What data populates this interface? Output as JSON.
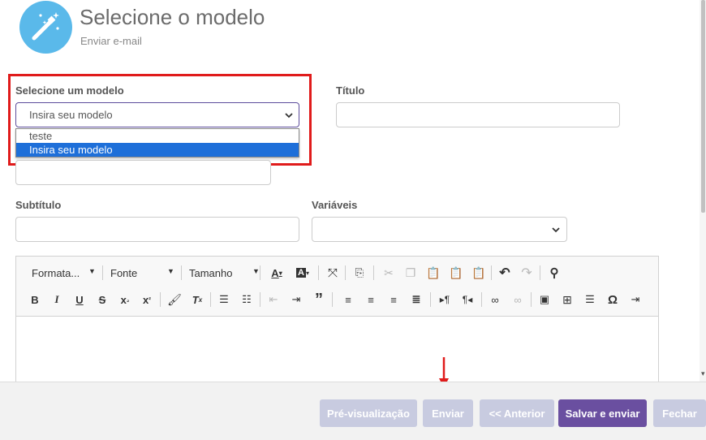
{
  "header": {
    "title": "Selecione o modelo",
    "subtitle": "Enviar e-mail",
    "icon": "magic-wand-icon"
  },
  "form": {
    "model_label": "Selecione um modelo",
    "model_value": "Insira seu modelo",
    "model_options": [
      "teste",
      "Insira seu modelo"
    ],
    "title_label": "Título",
    "title_value": "",
    "subtitle_label": "Subtítulo",
    "subtitle_value": "",
    "variables_label": "Variáveis",
    "variables_value": ""
  },
  "toolbar": {
    "format_label": "Formata...",
    "font_label": "Fonte",
    "size_label": "Tamanho"
  },
  "footer": {
    "preview_label": "Pré-visualização",
    "send_label": "Enviar",
    "previous_label": "<< Anterior",
    "save_send_label": "Salvar e enviar",
    "close_label": "Fechar"
  },
  "colors": {
    "accent": "#6a4fa0",
    "highlight": "#e01b1b",
    "icon_bg": "#5ab9ea",
    "selected_option": "#1e6fd9"
  }
}
